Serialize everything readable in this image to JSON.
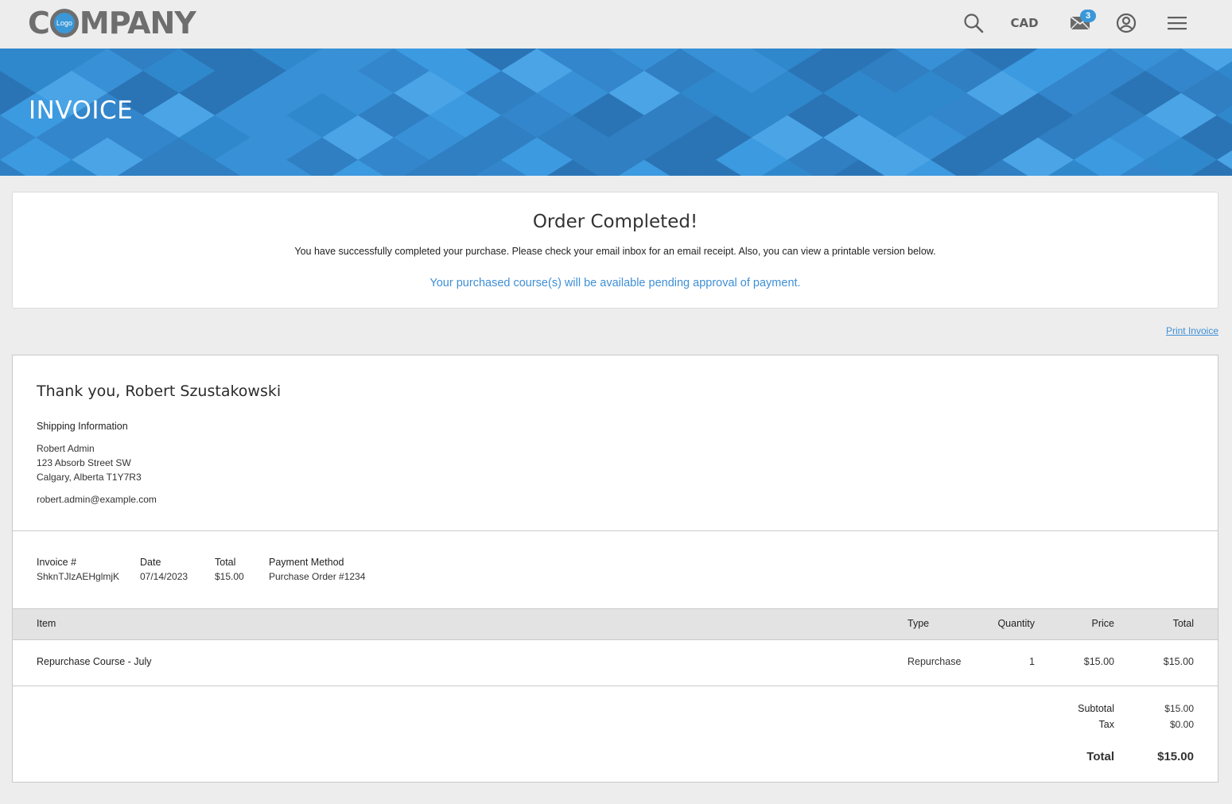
{
  "header": {
    "logo": {
      "letter": "C",
      "badge_text": "Logo",
      "rest": "MPANY"
    },
    "currency": "CAD",
    "mail_badge": "3",
    "icons": [
      "search-icon",
      "mail-icon",
      "user-icon",
      "menu-icon"
    ],
    "accent_color": "#3a97d8"
  },
  "banner": {
    "title": "INVOICE",
    "color": "#3b8fd0"
  },
  "order": {
    "title": "Order Completed!",
    "message": "You have successfully completed your purchase. Please check your email inbox for an email receipt. Also, you can view a printable version below.",
    "pending": "Your purchased course(s) will be available pending approval of payment."
  },
  "print_link": "Print Invoice",
  "invoice": {
    "thanks": "Thank you, Robert Szustakowski",
    "shipping_label": "Shipping Information",
    "address": {
      "name": "Robert Admin",
      "street": "123 Absorb Street SW",
      "city": "Calgary, Alberta T1Y7R3",
      "email": "robert.admin@example.com"
    },
    "meta": {
      "invoice_label": "Invoice #",
      "invoice_value": "ShknTJlzAEHglmjK",
      "date_label": "Date",
      "date_value": "07/14/2023",
      "total_label": "Total",
      "total_value": "$15.00",
      "payment_label": "Payment Method",
      "payment_value": "Purchase Order #1234"
    },
    "table": {
      "headers": {
        "item": "Item",
        "type": "Type",
        "quantity": "Quantity",
        "price": "Price",
        "total": "Total"
      },
      "rows": [
        {
          "item": "Repurchase Course - July",
          "type": "Repurchase",
          "quantity": "1",
          "price": "$15.00",
          "total": "$15.00"
        }
      ]
    },
    "summary": {
      "subtotal_label": "Subtotal",
      "subtotal_value": "$15.00",
      "tax_label": "Tax",
      "tax_value": "$0.00",
      "total_label": "Total",
      "total_value": "$15.00"
    }
  }
}
